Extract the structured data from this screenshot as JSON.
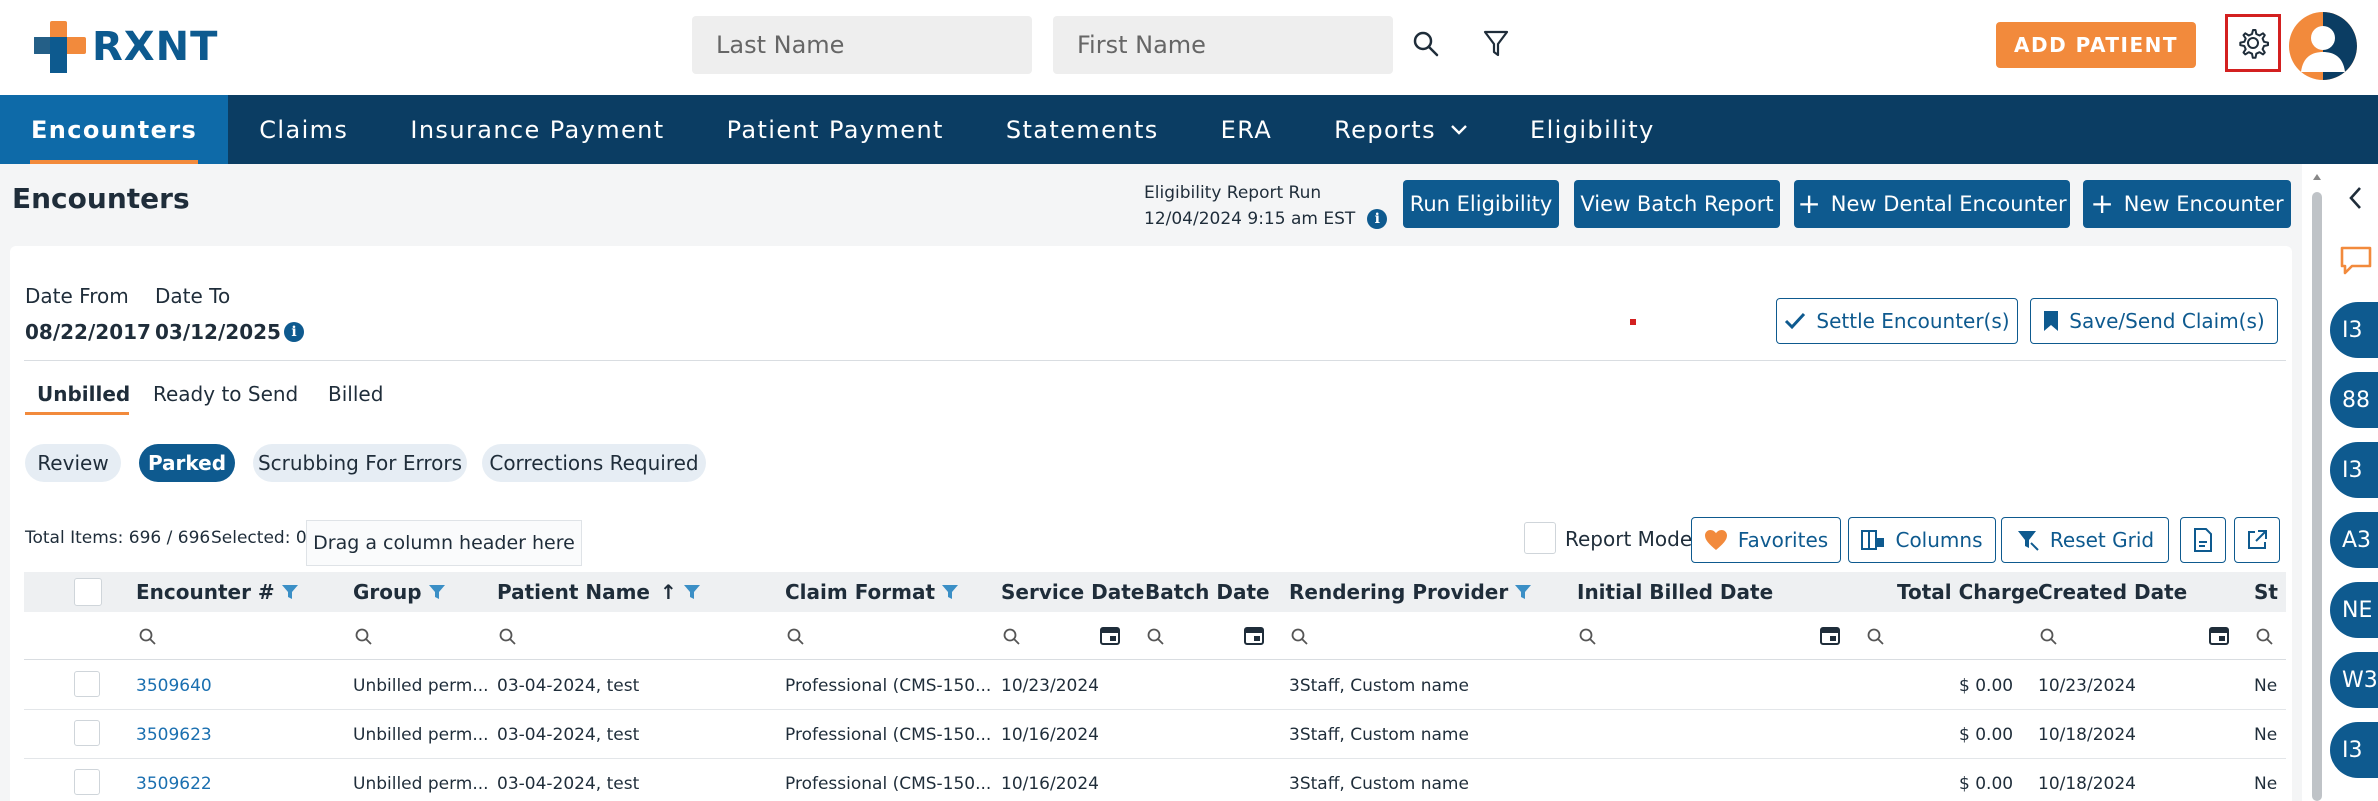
{
  "header": {
    "logo_text": "RXNT",
    "last_name_placeholder": "Last Name",
    "first_name_placeholder": "First Name",
    "add_patient_label": "ADD PATIENT"
  },
  "nav": {
    "items": [
      {
        "label": "Encounters",
        "active": true
      },
      {
        "label": "Claims"
      },
      {
        "label": "Insurance Payment"
      },
      {
        "label": "Patient Payment"
      },
      {
        "label": "Statements"
      },
      {
        "label": "ERA"
      },
      {
        "label": "Reports"
      },
      {
        "label": "Eligibility"
      }
    ]
  },
  "page": {
    "title": "Encounters",
    "eligibility_run_label": "Eligibility Report Run",
    "eligibility_run_time": "12/04/2024 9:15 am EST",
    "run_eligibility": "Run Eligibility",
    "view_batch_report": "View Batch Report",
    "new_dental_encounter": "New Dental Encounter",
    "new_encounter": "New Encounter"
  },
  "filters": {
    "date_from_label": "Date From",
    "date_from_value": "08/22/2017",
    "date_to_label": "Date To",
    "date_to_value": "03/12/2025",
    "settle_label": "Settle Encounter(s)",
    "save_send_label": "Save/Send Claim(s)"
  },
  "subtabs": [
    "Unbilled",
    "Ready to Send",
    "Billed"
  ],
  "pills": [
    "Review",
    "Parked",
    "Scrubbing For Errors",
    "Corrections Required"
  ],
  "grid_toolbar": {
    "total_items": "Total Items: 696 / 696",
    "selected": "Selected: 0",
    "drag_hint": "Drag a column header here",
    "report_mode": "Report Mode",
    "favorites": "Favorites",
    "columns": "Columns",
    "reset_grid": "Reset Grid"
  },
  "columns": [
    "Encounter #",
    "Group",
    "Patient Name",
    "Claim Format",
    "Service Date",
    "Batch Date",
    "Rendering Provider",
    "Initial Billed Date",
    "Total Charge",
    "Created Date",
    "St"
  ],
  "rows": [
    {
      "encounter": "3509640",
      "group": "Unbilled perm...",
      "patient": "03-04-2024, test",
      "format": "Professional (CMS-150...",
      "service": "10/23/2024",
      "provider": "3Staff, Custom name",
      "charge": "$ 0.00",
      "created": "10/23/2024",
      "status": "Ne"
    },
    {
      "encounter": "3509623",
      "group": "Unbilled perm...",
      "patient": "03-04-2024, test",
      "format": "Professional (CMS-150...",
      "service": "10/16/2024",
      "provider": "3Staff, Custom name",
      "charge": "$ 0.00",
      "created": "10/18/2024",
      "status": "Ne"
    },
    {
      "encounter": "3509622",
      "group": "Unbilled perm...",
      "patient": "03-04-2024, test",
      "format": "Professional (CMS-150...",
      "service": "10/16/2024",
      "provider": "3Staff, Custom name",
      "charge": "$ 0.00",
      "created": "10/18/2024",
      "status": "Ne"
    }
  ],
  "rail": {
    "badges": [
      "I3",
      "88",
      "I3",
      "A3",
      "NE",
      "W3",
      "I3"
    ]
  },
  "colors": {
    "nav_bg": "#0b3d63",
    "nav_active": "#0e6aa8",
    "accent_orange": "#f28a3c",
    "primary_blue": "#0e5a8f"
  }
}
